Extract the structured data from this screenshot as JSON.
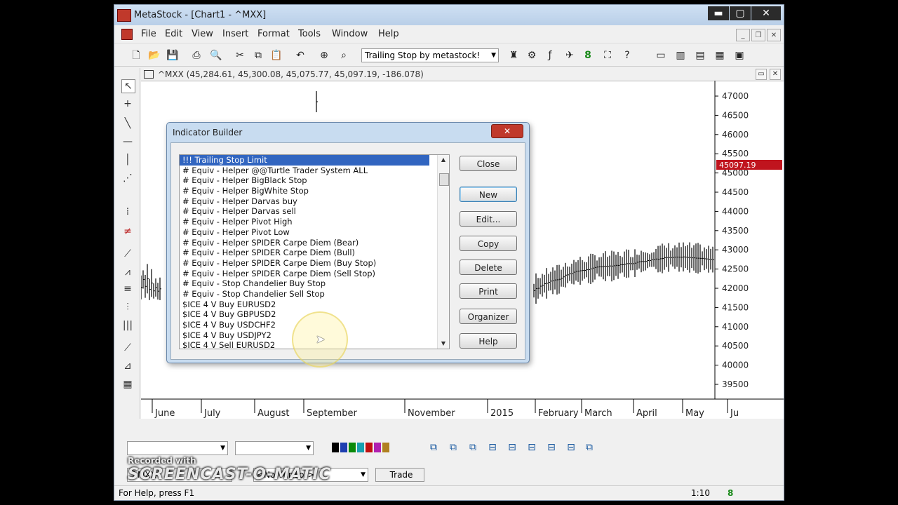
{
  "window": {
    "title": "MetaStock - [Chart1 - ^MXX]",
    "buttons": {
      "minimize": "▬",
      "maximize": "▢",
      "close": "✕"
    }
  },
  "menu": [
    "File",
    "Edit",
    "View",
    "Insert",
    "Format",
    "Tools",
    "Window",
    "Help"
  ],
  "toolbar": {
    "expert_combo": "Trailing Stop by metastock!"
  },
  "chart": {
    "header": "^MXX (45,284.61, 45,300.08, 45,075.77, 45,097.19, -186.078)",
    "price_label": "45097.19",
    "y_ticks": [
      "47000",
      "46500",
      "46000",
      "45500",
      "45000",
      "44500",
      "44000",
      "43500",
      "43000",
      "42500",
      "42000",
      "41500",
      "41000",
      "40500",
      "40000",
      "39500"
    ],
    "x_ticks": [
      "June",
      "July",
      "August",
      "September",
      "November",
      "2015",
      "February",
      "March",
      "April",
      "May",
      "Ju"
    ],
    "colors": {
      "price_badge": "#c0141e",
      "bars": "#000000"
    }
  },
  "dialog": {
    "title": "Indicator Builder",
    "close": "✕",
    "items": [
      "!!! Trailing Stop Limit",
      "# Equiv - Helper @@Turtle Trader System ALL",
      "# Equiv - Helper BigBlack Stop",
      "# Equiv - Helper BigWhite Stop",
      "# Equiv - Helper Darvas buy",
      "# Equiv - Helper Darvas sell",
      "# Equiv - Helper Pivot High",
      "# Equiv - Helper Pivot Low",
      "# Equiv - Helper SPIDER Carpe Diem (Bear)",
      "# Equiv - Helper SPIDER Carpe Diem (Bull)",
      "# Equiv - Helper SPIDER Carpe Diem (Buy Stop)",
      "# Equiv - Helper SPIDER Carpe Diem (Sell Stop)",
      "# Equiv - Stop Chandelier Buy Stop",
      "# Equiv - Stop Chandelier Sell Stop",
      "$ICE 4 V Buy EURUSD2",
      "$ICE 4 V Buy GBPUSD2",
      "$ICE 4 V Buy USDCHF2",
      "$ICE 4 V Buy USDJPY2",
      "$ICE 4 V Sell EURUSD2"
    ],
    "buttons": [
      "Close",
      "New",
      "Edit...",
      "Copy",
      "Delete",
      "Print",
      "Organizer",
      "Help"
    ]
  },
  "bottom": {
    "symbol": "^MXX",
    "vendor": "<No Vendor>",
    "trade": "Trade",
    "status": "For Help, press F1",
    "time": "1:10",
    "indicator": "8"
  },
  "watermark": {
    "line1": "Recorded with",
    "line2": "SCREENCAST-O-MATIC"
  }
}
